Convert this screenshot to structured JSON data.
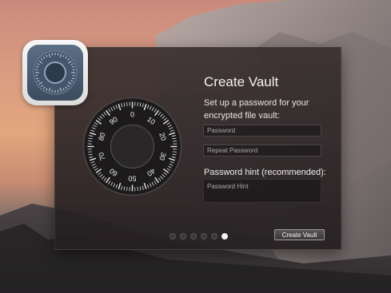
{
  "dialog": {
    "title": "Create Vault",
    "subtitle": "Set up a password for your encrypted file vault:",
    "password_placeholder": "Password",
    "repeat_password_placeholder": "Repeat Password",
    "hint_label": "Password hint (recommended):",
    "hint_placeholder": "Password Hint",
    "create_button": "Create Vault"
  },
  "dial": {
    "numbers": [
      "0",
      "10",
      "20",
      "30",
      "40",
      "50",
      "60",
      "70",
      "80",
      "90"
    ]
  },
  "pagination": {
    "total_pages": 6,
    "current_page": 6
  },
  "icons": {
    "app": "vault-dial-icon",
    "dial": "combination-lock-dial-icon"
  },
  "colors": {
    "accent_text": "#f2f2f2",
    "panel": "#2f2829"
  }
}
